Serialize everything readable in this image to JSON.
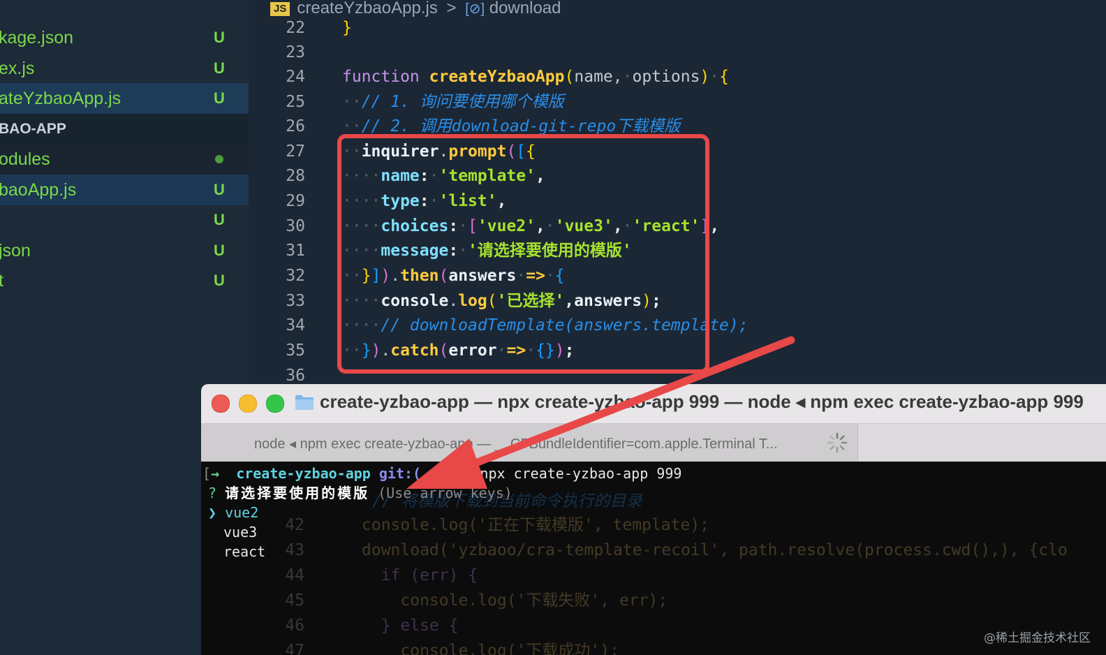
{
  "sidebar": {
    "items": [
      {
        "name": "kage.json",
        "status": "U"
      },
      {
        "name": "ex.js",
        "status": "U"
      },
      {
        "name": "ateYzbaoApp.js",
        "status": "U"
      },
      {
        "name": "BAO-APP",
        "status": ""
      },
      {
        "name": "odules",
        "status": ""
      },
      {
        "name": "baoApp.js",
        "status": "U"
      },
      {
        "name": "",
        "status": "U"
      },
      {
        "name": "json",
        "status": "U"
      },
      {
        "name": "t",
        "status": "U"
      }
    ]
  },
  "editor": {
    "breadcrumb": {
      "badge": "JS",
      "file": "createYzbaoApp.js",
      "separator": ">",
      "symbol_icon": "[⊘]",
      "symbol": "download"
    },
    "line_numbers": [
      "22",
      "23",
      "24",
      "25",
      "26",
      "27",
      "28",
      "29",
      "30",
      "31",
      "32",
      "33",
      "34",
      "35",
      "36"
    ],
    "code": {
      "l22": "}",
      "l24_kw": "function",
      "l24_fn": "createYzbaoApp",
      "l24_p1": "name",
      "l24_p2": "options",
      "l25": "// 1. 询问要使用哪个模版",
      "l26": "// 2. 调用download-git-repo下载模版",
      "l27_obj": "inquirer",
      "l27_fn": "prompt",
      "l28_key": "name",
      "l28_val": "'template'",
      "l29_key": "type",
      "l29_val": "'list'",
      "l30_key": "choices",
      "l30_v1": "'vue2'",
      "l30_v2": "'vue3'",
      "l30_v3": "'react'",
      "l31_key": "message",
      "l31_val": "'请选择要使用的模版'",
      "l32_fn": "then",
      "l32_arg": "answers",
      "l33_obj": "console",
      "l33_fn": "log",
      "l33_str": "'已选择'",
      "l33_arg": "answers",
      "l34": "// downloadTemplate(answers.template);",
      "l35_fn": "catch",
      "l35_arg": "error"
    }
  },
  "terminal": {
    "title": "create-yzbao-app — npx create-yzbao-app 999 — node ◂ npm exec create-yzbao-app 999",
    "tab": "node ◂ npm exec create-yzbao-app — __CFBundleIdentifier=com.apple.Terminal T...",
    "prompt_bracket": "[",
    "prompt_arrow": "→",
    "prompt_dir": "create-yzbao-app",
    "prompt_git": "git:(",
    "prompt_x": "✗",
    "command": "npx create-yzbao-app 999",
    "question_mark": "?",
    "question": "请选择要使用的模版",
    "hint": "(Use arrow keys)",
    "pointer": "❯",
    "options": [
      "vue2",
      "vue3",
      "react"
    ],
    "ghost_lines": [
      {
        "ln": "",
        "code": "// 将模版下载到当前命令执行的目录"
      },
      {
        "ln": "42",
        "code": "console.log('正在下载模版', template);"
      },
      {
        "ln": "43",
        "code": "download('yzbaoo/cra-template-recoil', path.resolve(process.cwd(),), {clo"
      },
      {
        "ln": "44",
        "code": "  if (err) {"
      },
      {
        "ln": "45",
        "code": "    console.log('下载失败', err);"
      },
      {
        "ln": "46",
        "code": "  } else {"
      },
      {
        "ln": "47",
        "code": "    console.log('下载成功');"
      }
    ]
  },
  "watermark": "@稀土掘金技术社区",
  "colors": {
    "accent": "#e84848",
    "git_added": "#7bd84a"
  }
}
